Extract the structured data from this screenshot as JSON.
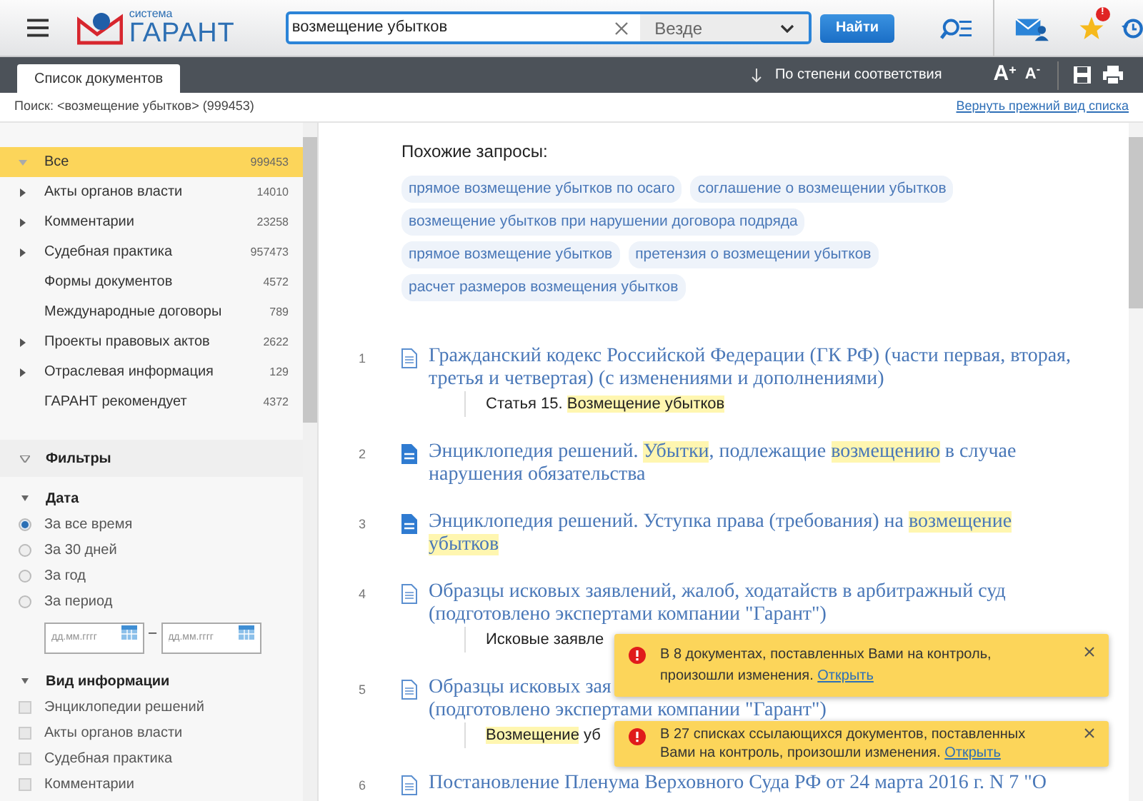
{
  "header": {
    "logo_small": "система",
    "logo_big": "ГАРАНТ",
    "search": {
      "value": "возмещение убытков",
      "scope": "Везде"
    },
    "search_button": "Найти",
    "favorites_badge": "!"
  },
  "toolbar": {
    "tabs": [
      {
        "label": "Список документов",
        "selected": true
      }
    ],
    "sort": "По степени соответствия",
    "font_bigger": "A",
    "font_bigger_sup": "+",
    "font_smaller": "A",
    "font_smaller_sup": "-"
  },
  "breadcrumb": {
    "text": "Поиск: <возмещение убытков> (999453)",
    "link": "Вернуть прежний вид списка"
  },
  "sidebar": {
    "items": [
      {
        "label": "Все",
        "count": "999453",
        "selected": true,
        "kind": "group",
        "expanded": true
      },
      {
        "label": "Акты органов власти",
        "count": "14010",
        "selected": false,
        "kind": "group",
        "expanded": false
      },
      {
        "label": "Комментарии",
        "count": "23258",
        "selected": false,
        "kind": "group",
        "expanded": false
      },
      {
        "label": "Судебная практика",
        "count": "957473",
        "selected": false,
        "kind": "group",
        "expanded": false
      },
      {
        "label": "Формы документов",
        "count": "4572",
        "selected": false,
        "kind": "leaf"
      },
      {
        "label": "Международные договоры",
        "count": "789",
        "selected": false,
        "kind": "leaf"
      },
      {
        "label": "Проекты правовых актов",
        "count": "2622",
        "selected": false,
        "kind": "group",
        "expanded": false
      },
      {
        "label": "Отраслевая информация",
        "count": "129",
        "selected": false,
        "kind": "group",
        "expanded": false
      },
      {
        "label": "ГАРАНТ рекомендует",
        "count": "4372",
        "selected": false,
        "kind": "leaf"
      }
    ],
    "filters": {
      "title": "Фильтры",
      "date": {
        "title": "Дата",
        "options": [
          {
            "label": "За все время",
            "selected": true
          },
          {
            "label": "За 30 дней",
            "selected": false
          },
          {
            "label": "За год",
            "selected": false
          },
          {
            "label": "За период",
            "selected": false
          }
        ],
        "from_placeholder": "дд.мм.гггг",
        "dash": "–",
        "to_placeholder": "дд.мм.гггг"
      },
      "info_type": {
        "title": "Вид информации",
        "options": [
          {
            "label": "Энциклопедии решений",
            "checked": false
          },
          {
            "label": "Акты органов власти",
            "checked": false
          },
          {
            "label": "Судебная практика",
            "checked": false
          },
          {
            "label": "Комментарии",
            "checked": false
          }
        ]
      }
    }
  },
  "similar": {
    "title": "Похожие запросы:",
    "queries": [
      "прямое возмещение убытков по осаго",
      "соглашение о возмещении убытков",
      "возмещение убытков при нарушении договора подряда",
      "прямое возмещение убытков",
      "претензия о возмещении убытков",
      "расчет размеров возмещения убытков"
    ]
  },
  "results": [
    {
      "number": "1",
      "kind": "document",
      "title": [
        [
          {
            "text": "Гражданский кодекс Российской Федерации (ГК РФ) (части первая, вторая,",
            "highlight": false
          }
        ],
        [
          {
            "text": "третья и четвертая) (с изменениями и дополнениями)",
            "highlight": false
          }
        ]
      ],
      "snippet": [
        {
          "text": "Статья 15. ",
          "highlight": false
        },
        {
          "text": "Возмещение убытков",
          "highlight": true
        }
      ]
    },
    {
      "number": "2",
      "kind": "encyclopedia",
      "title": [
        [
          {
            "text": "Энциклопедия решений. ",
            "highlight": false
          },
          {
            "text": "Убытки",
            "highlight": true
          },
          {
            "text": ", подлежащие ",
            "highlight": false
          },
          {
            "text": "возмещению",
            "highlight": true
          },
          {
            "text": " в случае",
            "highlight": false
          }
        ],
        [
          {
            "text": "нарушения обязательства",
            "highlight": false
          }
        ]
      ]
    },
    {
      "number": "3",
      "kind": "encyclopedia",
      "title": [
        [
          {
            "text": "Энциклопедия решений. Уступка права (требования) на ",
            "highlight": false
          },
          {
            "text": "возмещение",
            "highlight": true
          }
        ],
        [
          {
            "text": "убытков",
            "highlight": true
          }
        ]
      ]
    },
    {
      "number": "4",
      "kind": "document",
      "title": [
        [
          {
            "text": "Образцы исковых заявлений, жалоб, ходатайств в арбитражный суд",
            "highlight": false
          }
        ],
        [
          {
            "text": "(подготовлено экспертами компании \"Гарант\")",
            "highlight": false
          }
        ]
      ],
      "snippet": [
        {
          "text": "Исковые заявле",
          "highlight": false
        }
      ]
    },
    {
      "number": "5",
      "kind": "document",
      "title": [
        [
          {
            "text": "Образцы исковых зая",
            "highlight": false
          }
        ],
        [
          {
            "text": "(подготовлено экспертами компании \"Гарант\")",
            "highlight": false
          }
        ]
      ],
      "snippet": [
        {
          "text": "Возмещение",
          "highlight": true
        },
        {
          "text": " уб",
          "highlight": false
        }
      ]
    },
    {
      "number": "6",
      "kind": "document",
      "title": [
        [
          {
            "text": "Постановление Пленума Верховного Суда РФ от 24 марта 2016 г. N 7 \"О",
            "highlight": false
          }
        ]
      ]
    }
  ],
  "notifications": [
    {
      "message": "В 8 документах, поставленных Вами на контроль, произошли изменения.",
      "link": "Открыть"
    },
    {
      "message": "В 27 списках ссылающихся документов, поставленных Вами на контроль, произошли изменения.",
      "link": "Открыть"
    }
  ]
}
